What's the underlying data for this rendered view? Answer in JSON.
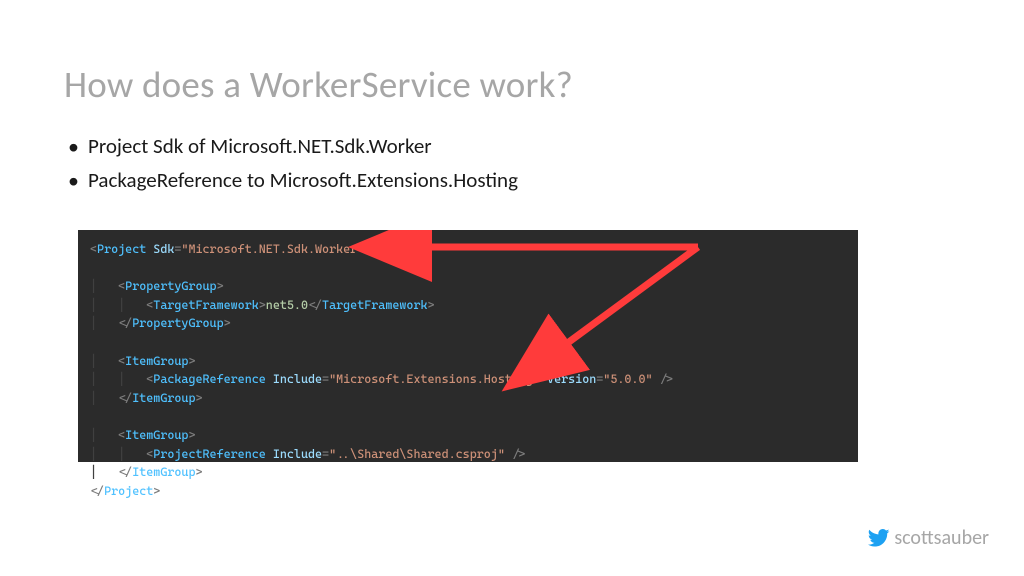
{
  "title": "How does a WorkerService work?",
  "bullets": [
    "Project Sdk of Microsoft.NET.Sdk.Worker",
    "PackageReference to Microsoft.Extensions.Hosting"
  ],
  "code": {
    "project_tag": "Project",
    "sdk_attr": "Sdk",
    "sdk_val": "Microsoft.NET.Sdk.Worker",
    "propertygroup_tag": "PropertyGroup",
    "targetframework_tag": "TargetFramework",
    "targetframework_val": "net5.0",
    "itemgroup_tag": "ItemGroup",
    "packageref_tag": "PackageReference",
    "include_attr": "Include",
    "packageref_include_val": "Microsoft.Extensions.Hosting",
    "version_attr": "Version",
    "version_val": "5.0.0",
    "projectref_tag": "ProjectReference",
    "projectref_include_val": "..\\Shared\\Shared.csproj"
  },
  "footer": {
    "handle": "scottsauber"
  },
  "arrow": {
    "color": "#ff3b3b"
  }
}
